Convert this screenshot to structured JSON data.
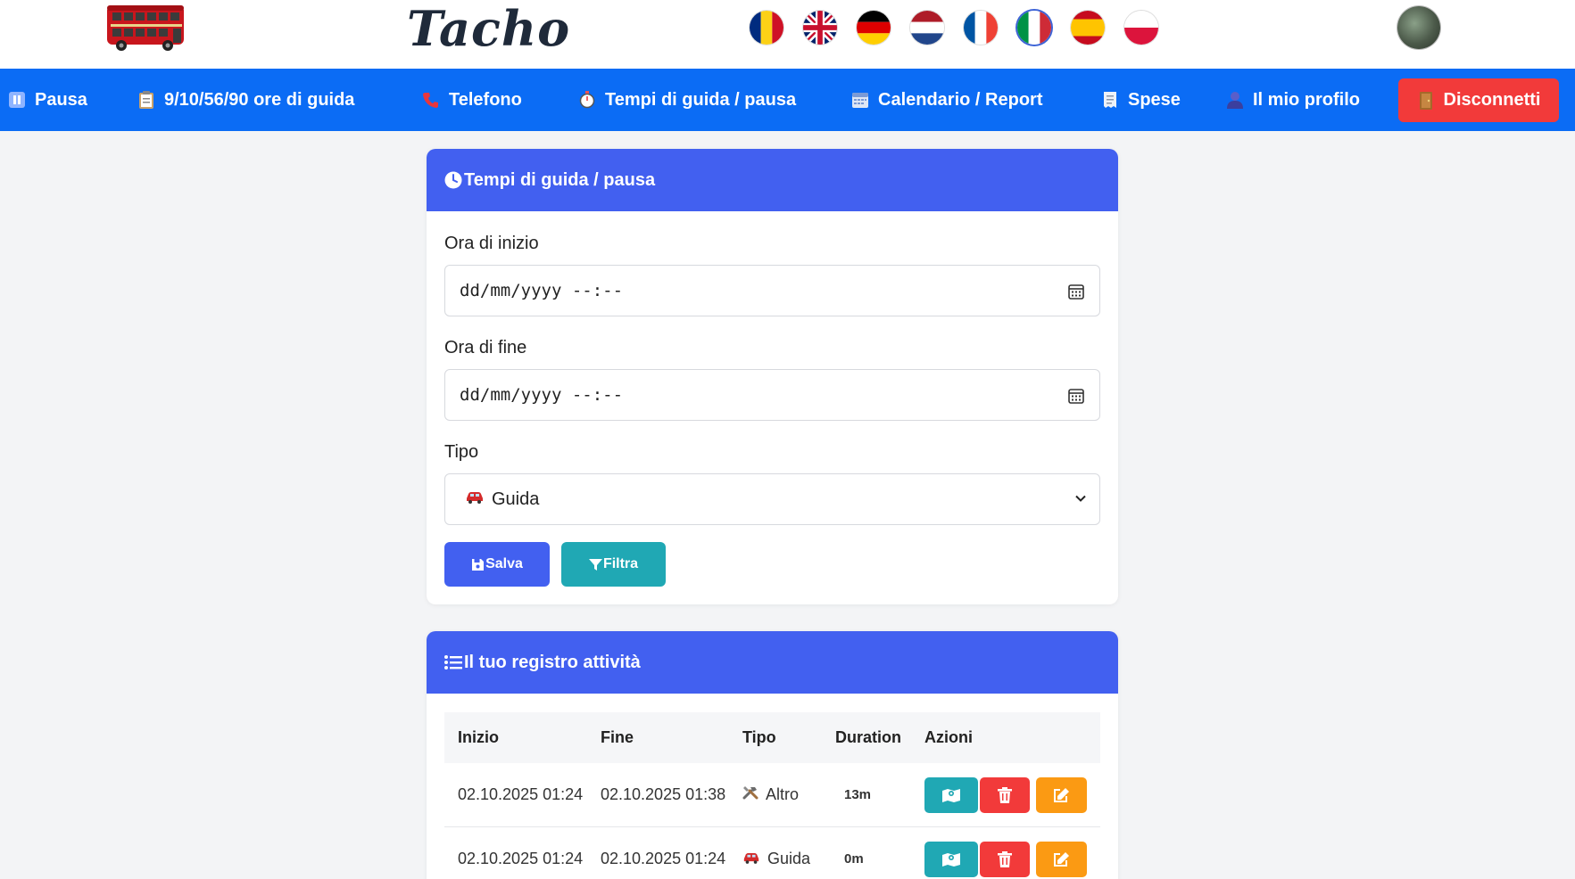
{
  "header": {
    "brand": "Tacho",
    "flags": [
      {
        "code": "ro",
        "name": "romania-flag"
      },
      {
        "code": "gb",
        "name": "uk-flag"
      },
      {
        "code": "de",
        "name": "germany-flag"
      },
      {
        "code": "nl",
        "name": "netherlands-flag"
      },
      {
        "code": "fr",
        "name": "france-flag"
      },
      {
        "code": "it",
        "name": "italy-flag",
        "selected": true
      },
      {
        "code": "es",
        "name": "spain-flag"
      },
      {
        "code": "pl",
        "name": "poland-flag"
      }
    ]
  },
  "nav": {
    "items": [
      {
        "label": "Pausa",
        "icon": "pause-icon"
      },
      {
        "label": "9/10/56/90 ore di guida",
        "icon": "clipboard-icon"
      },
      {
        "label": "Telefono",
        "icon": "phone-icon"
      },
      {
        "label": "Tempi di guida / pausa",
        "icon": "stopwatch-icon"
      },
      {
        "label": "Calendario / Report",
        "icon": "calendar-icon"
      },
      {
        "label": "Spese",
        "icon": "receipt-icon"
      },
      {
        "label": "Il mio profilo",
        "icon": "user-icon"
      }
    ],
    "logout": {
      "label": "Disconnetti",
      "icon": "door-icon"
    }
  },
  "form_card": {
    "title": "Tempi di guida / pausa",
    "start_label": "Ora di inizio",
    "start_placeholder": "dd/mm/yyyy --:--",
    "end_label": "Ora di fine",
    "end_placeholder": "dd/mm/yyyy --:--",
    "type_label": "Tipo",
    "type_selected": "Guida",
    "save_label": "Salva",
    "filter_label": "Filtra"
  },
  "log_card": {
    "title": "Il tuo registro attività",
    "columns": [
      "Inizio",
      "Fine",
      "Tipo",
      "Duration",
      "Azioni"
    ],
    "rows": [
      {
        "start": "02.10.2025 01:24",
        "end": "02.10.2025 01:38",
        "type": "Altro",
        "type_icon": "tools-icon",
        "duration": "13m"
      },
      {
        "start": "02.10.2025 01:24",
        "end": "02.10.2025 01:24",
        "type": "Guida",
        "type_icon": "car-icon",
        "duration": "0m"
      }
    ]
  },
  "colors": {
    "nav": "#0b6cf5",
    "card_header": "#4260f0",
    "logout": "#f23a3a",
    "teal": "#20a8b4",
    "orange": "#fb9a13"
  }
}
